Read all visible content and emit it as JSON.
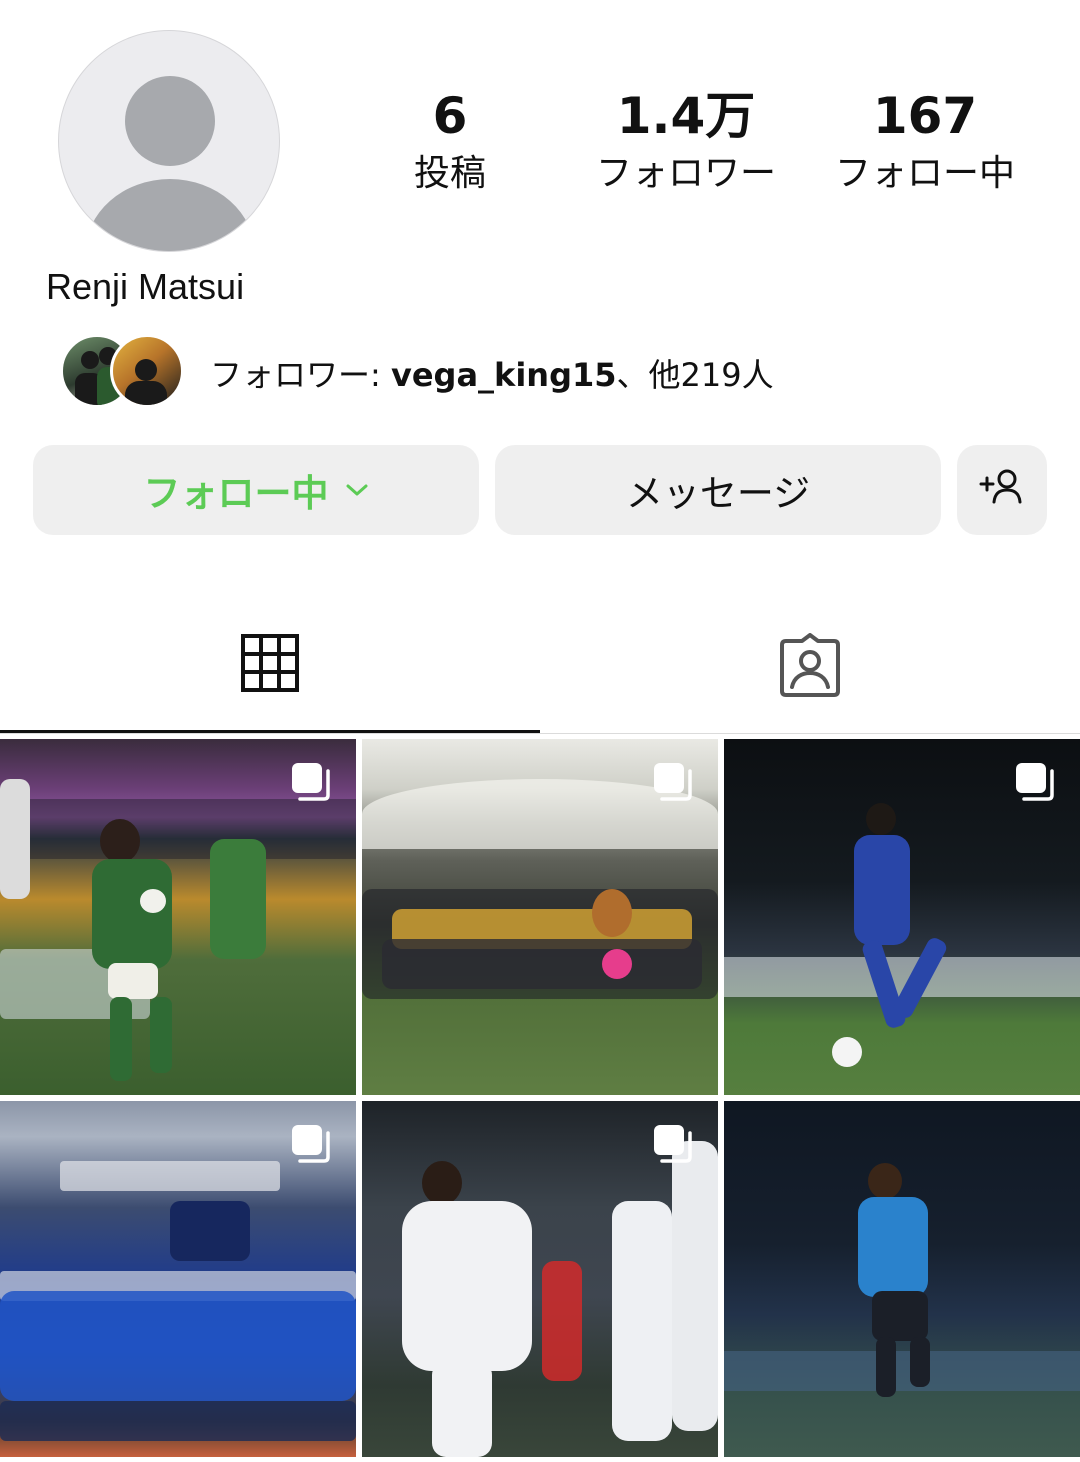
{
  "profile": {
    "name": "Renji Matsui",
    "stats": {
      "posts_count": "6",
      "posts_label": "投稿",
      "followers_count": "1.4万",
      "followers_label": "フォロワー",
      "following_count": "167",
      "following_label": "フォロー中"
    },
    "mutual": {
      "prefix": "フォロワー: ",
      "user": "vega_king15",
      "suffix": "、他219人"
    }
  },
  "buttons": {
    "follow_label": "フォロー中",
    "message_label": "メッセージ",
    "add_user_icon": "person-add-icon"
  },
  "tabs": [
    {
      "icon": "grid-icon",
      "selected": true
    },
    {
      "icon": "tagged-person-icon",
      "selected": false
    }
  ],
  "posts": [
    {
      "multiple": true
    },
    {
      "multiple": true
    },
    {
      "multiple": true
    },
    {
      "multiple": true
    },
    {
      "multiple": true
    },
    {
      "multiple": false
    }
  ],
  "colors": {
    "follow_text": "#5ccb55",
    "button_bg": "#efefef",
    "avatar_placeholder": "#a7a9ad"
  }
}
